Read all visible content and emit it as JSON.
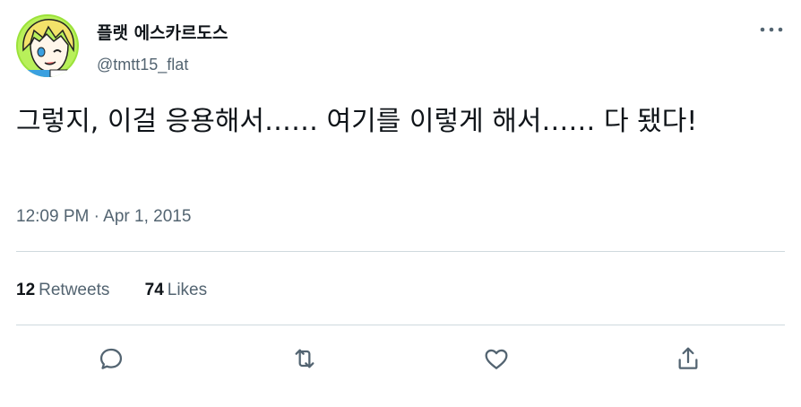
{
  "author": {
    "display_name": "플랫 에스카르도스",
    "handle": "@tmtt15_flat"
  },
  "tweet": {
    "text": "그렇지, 이걸 응용해서…… 여기를 이렇게 해서…… 다 됐다!",
    "timestamp": "12:09 PM · Apr 1, 2015"
  },
  "stats": {
    "retweets_count": "12",
    "retweets_label": "Retweets",
    "likes_count": "74",
    "likes_label": "Likes"
  },
  "actions": [
    "reply-icon",
    "retweet-icon",
    "like-icon",
    "share-icon"
  ],
  "colors": {
    "text": "#0f1419",
    "secondary": "#536471",
    "divider": "#cfd9de"
  }
}
